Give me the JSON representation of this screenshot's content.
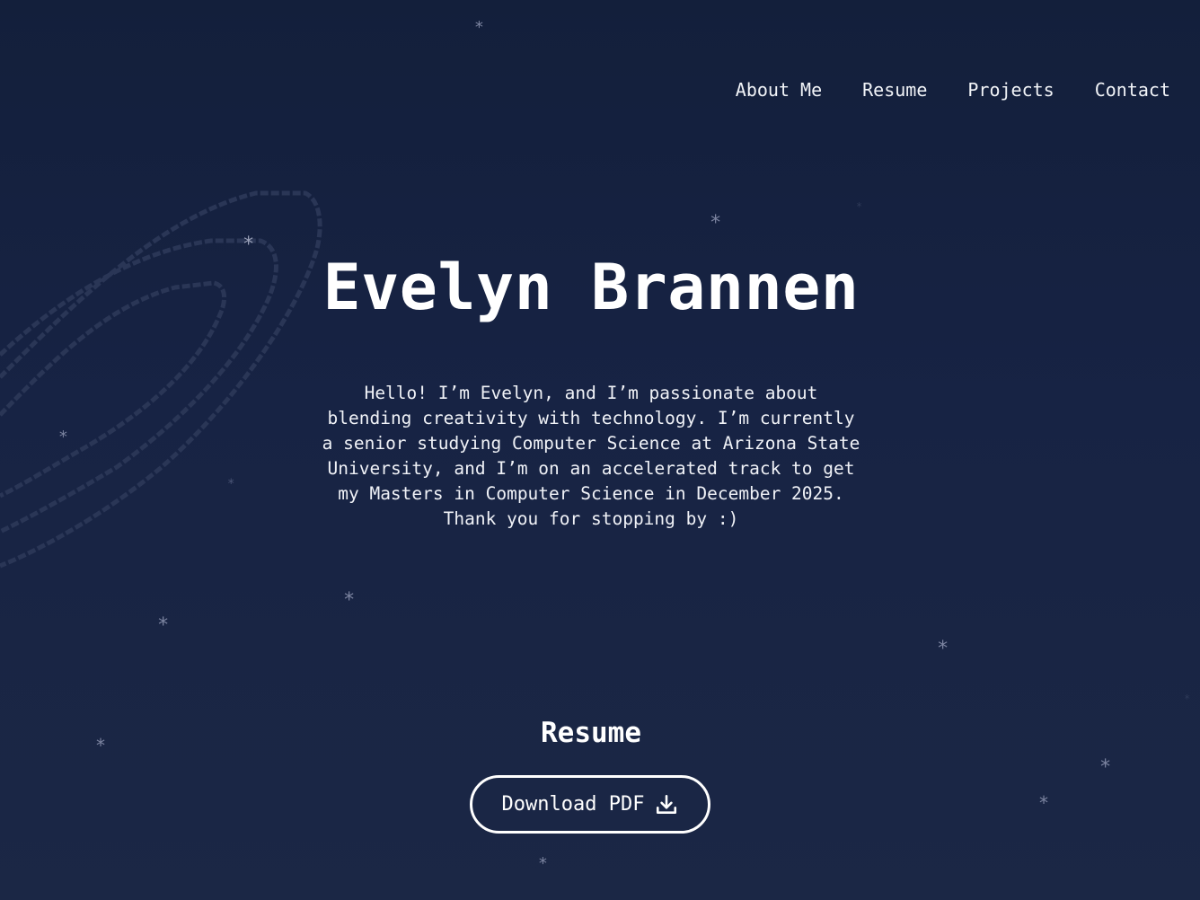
{
  "nav": {
    "items": [
      {
        "label": "About Me"
      },
      {
        "label": "Resume"
      },
      {
        "label": "Projects"
      },
      {
        "label": "Contact"
      }
    ]
  },
  "hero": {
    "title": "Evelyn Brannen",
    "bio": "Hello! I’m Evelyn, and I’m passionate about blending creativity with technology. I’m currently a senior studying Computer Science at Arizona State University, and I’m on an accelerated track to get my Masters in Computer Science in December 2025. Thank you for stopping by :)"
  },
  "resume": {
    "title": "Resume",
    "download_label": "Download PDF",
    "download_icon": "download-icon"
  },
  "decor": {
    "star_glyph": "*",
    "star_color": "#7c84a0",
    "background_color": "#172344",
    "swirl_color": "#2a3656"
  }
}
